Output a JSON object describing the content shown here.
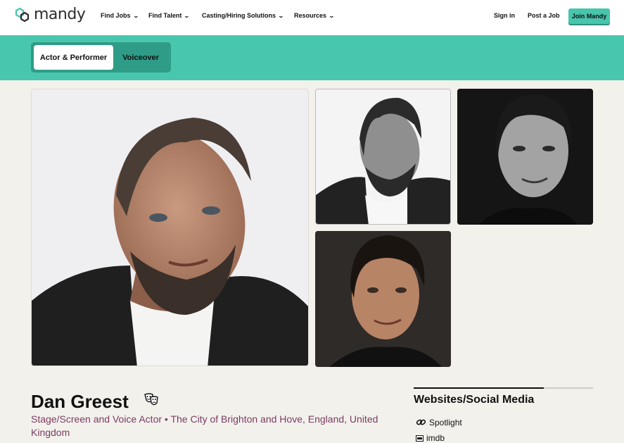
{
  "header": {
    "brand": "mandy",
    "nav": [
      {
        "label": "Find Jobs"
      },
      {
        "label": "Find Talent"
      },
      {
        "label": "Casting/Hiring Solutions"
      },
      {
        "label": "Resources"
      }
    ],
    "sign_in": "Sign in",
    "post_job": "Post a Job",
    "join": "Join Mandy",
    "accent_color": "#48c7ae"
  },
  "tabs": [
    {
      "label": "Actor & Performer",
      "active": true
    },
    {
      "label": "Voiceover",
      "active": false
    }
  ],
  "gallery": [
    {
      "icon": "headshot-color-photo"
    },
    {
      "icon": "headshot-bw-photo"
    },
    {
      "icon": "headshot-bw-photo"
    },
    {
      "icon": "headshot-color-photo"
    }
  ],
  "profile": {
    "name": "Dan Greest",
    "subtitle": "Stage/Screen and Voice Actor • The City of Brighton and Hove, England, United Kingdom",
    "subtitle_color": "#7a3c63"
  },
  "sidebar": {
    "title": "Websites/Social Media",
    "links": [
      {
        "label": "Spotlight",
        "icon": "link-icon"
      },
      {
        "label": "imdb",
        "icon": "imdb-icon"
      }
    ]
  }
}
